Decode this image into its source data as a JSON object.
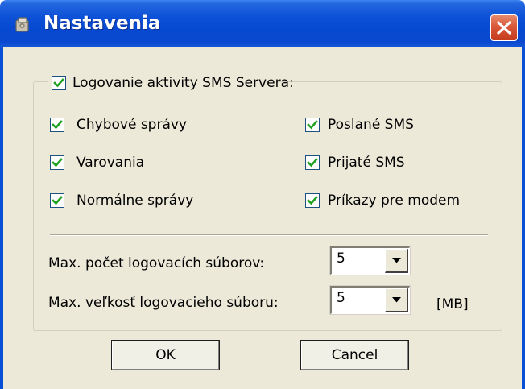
{
  "window": {
    "title": "Nastavenia",
    "icon": "settings-app-icon",
    "close_icon": "close-icon"
  },
  "logging_group": {
    "label": "Logovanie aktivity SMS Servera:",
    "checked": true,
    "options": [
      {
        "label": "Chybové správy",
        "checked": true
      },
      {
        "label": "Poslané SMS",
        "checked": true
      },
      {
        "label": "Varovania",
        "checked": true
      },
      {
        "label": "Prijaté SMS",
        "checked": true
      },
      {
        "label": "Normálne správy",
        "checked": true
      },
      {
        "label": "Príkazy pre modem",
        "checked": true
      }
    ],
    "max_files_label": "Max. počet logovacích súborov:",
    "max_files_value": "5",
    "max_size_label": "Max. veľkosť logovacieho súboru:",
    "max_size_value": "5",
    "max_size_unit": "[MB]"
  },
  "buttons": {
    "ok": "OK",
    "cancel": "Cancel"
  },
  "colors": {
    "titlebar": "#0a4fd7",
    "dialog_bg": "#ece9d8",
    "close_button": "#d9573a"
  }
}
